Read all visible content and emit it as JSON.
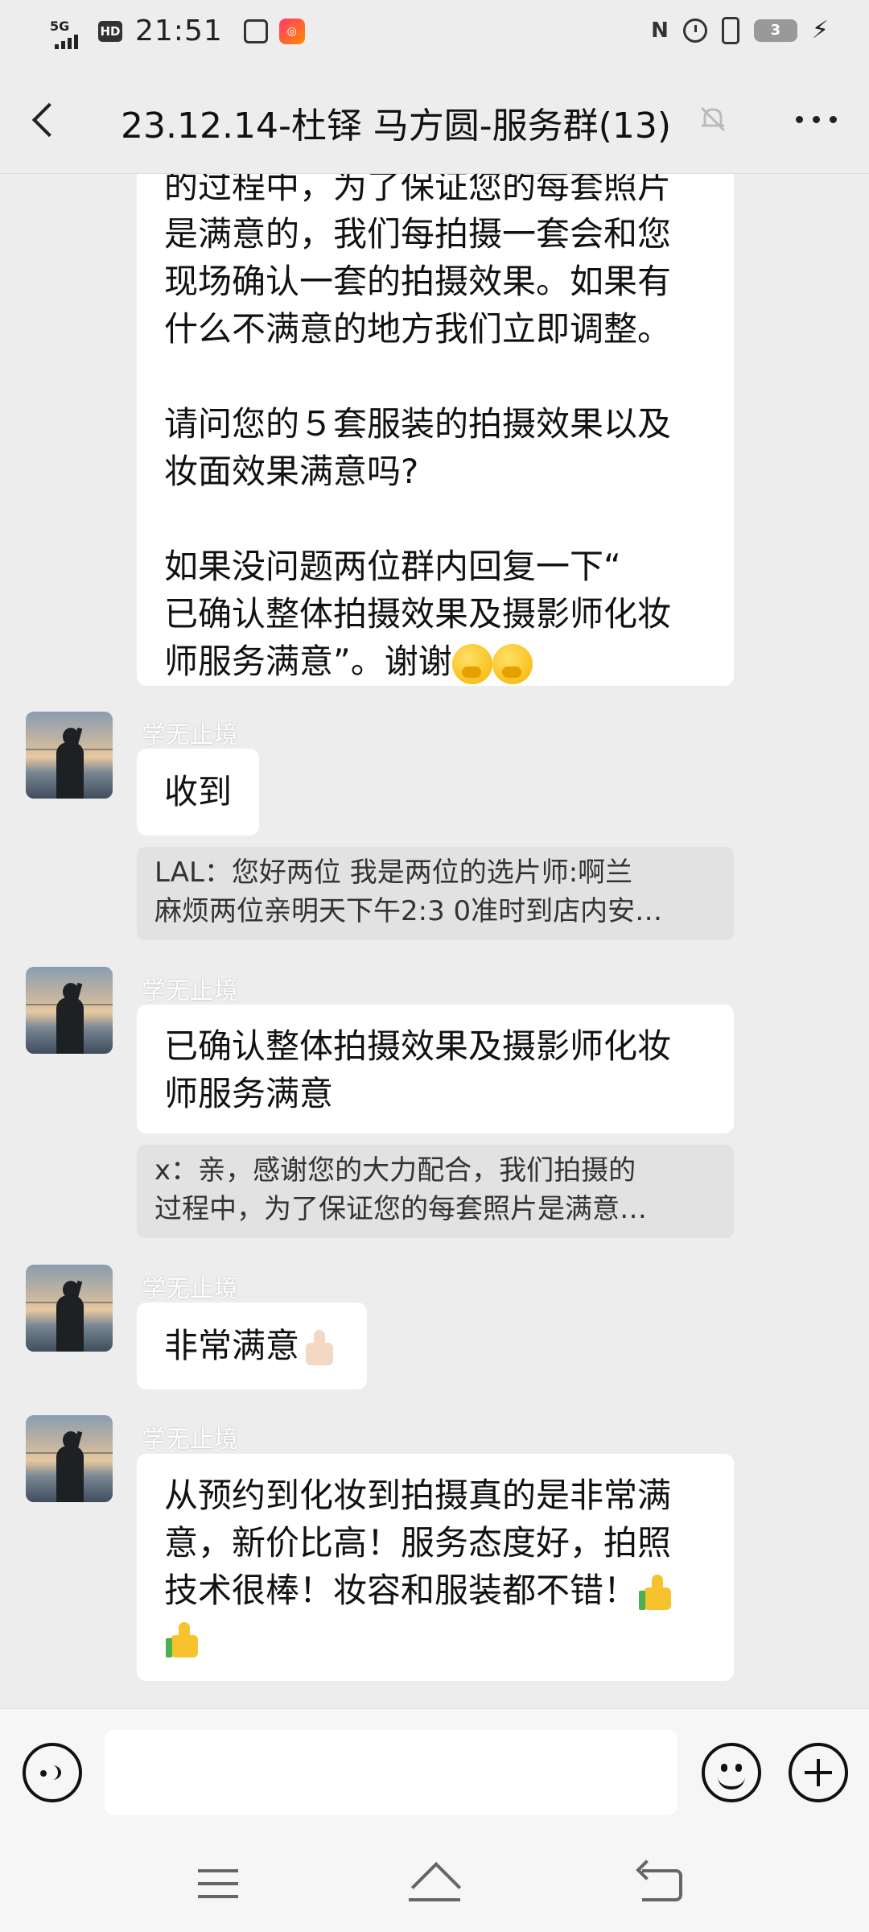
{
  "status_bar": {
    "network": "5G",
    "hd": "HD",
    "time": "21:51",
    "nfc": "N",
    "battery": "3"
  },
  "header": {
    "back_icon": "chevron-left-icon",
    "title": "23.12.14-杜铎 马方圆-服务群(13)",
    "mute_icon": "bell-off-icon",
    "more_icon": "more-dots-icon"
  },
  "messages": [
    {
      "type": "incoming",
      "lines_a": [
        "的过程中，为了保证您的每套照片",
        "是满意的，我们每拍摄一套会和您",
        "现场确认一套的拍摄效果。如果有",
        "什么不满意的地方我们立即调整。"
      ],
      "lines_b": [
        "请问您的５套服装的拍摄效果以及",
        "妆面效果满意吗?"
      ],
      "lines_c": [
        "如果没问题两位群内回复一下“",
        "已确认整体拍摄效果及摄影师化妆"
      ],
      "last_line": "师服务满意”。谢谢"
    },
    {
      "sender": "学无止境",
      "text": "收到"
    },
    {
      "quote": [
        "LAL：您好两位 我是两位的选片师:啊兰",
        "麻烦两位亲明天下午2:3 0准时到店内安…"
      ]
    },
    {
      "sender": "学无止境",
      "lines": [
        "已确认整体拍摄效果及摄影师化妆",
        "师服务满意"
      ]
    },
    {
      "quote": [
        "x：亲，感谢您的大力配合，我们拍摄的",
        "过程中，为了保证您的每套照片是满意…"
      ]
    },
    {
      "sender": "学无止境",
      "text": "非常满意"
    },
    {
      "sender": "学无止境",
      "lines": [
        "从预约到化妆到拍摄真的是非常满",
        "意，新价比高！服务态度好，拍照",
        "技术很棒！妆容和服装都不错！"
      ]
    }
  ],
  "input_bar": {
    "voice_icon": "voice-icon",
    "emoji_icon": "emoji-icon",
    "plus_icon": "plus-icon"
  },
  "colors": {
    "background": "#ededed",
    "bubble": "#ffffff",
    "quote": "#e2e2e2"
  }
}
